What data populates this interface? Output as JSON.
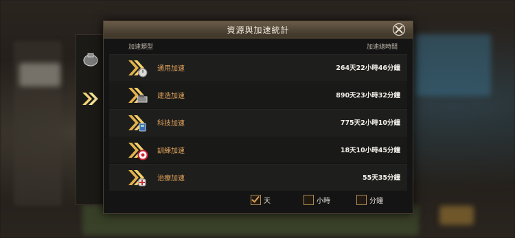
{
  "dialog": {
    "title": "資源與加速統計"
  },
  "columns": {
    "type": "加速類型",
    "total": "加速總時間"
  },
  "rows": [
    {
      "label": "通用加速",
      "time": "264天22小時46分鐘",
      "icon": "general-speedup-icon"
    },
    {
      "label": "建造加速",
      "time": "890天23小時32分鐘",
      "icon": "construction-speedup-icon"
    },
    {
      "label": "科技加速",
      "time": "775天2小時10分鐘",
      "icon": "research-speedup-icon"
    },
    {
      "label": "訓練加速",
      "time": "18天10小時45分鐘",
      "icon": "training-speedup-icon"
    },
    {
      "label": "治療加速",
      "time": "55天35分鐘",
      "icon": "healing-speedup-icon"
    }
  ],
  "units": [
    {
      "label": "天",
      "checked": true
    },
    {
      "label": "小時",
      "checked": false
    },
    {
      "label": "分鐘",
      "checked": false
    }
  ],
  "colors": {
    "accent": "#e0a25a",
    "header": "#4f4435",
    "panel": "#141414"
  }
}
